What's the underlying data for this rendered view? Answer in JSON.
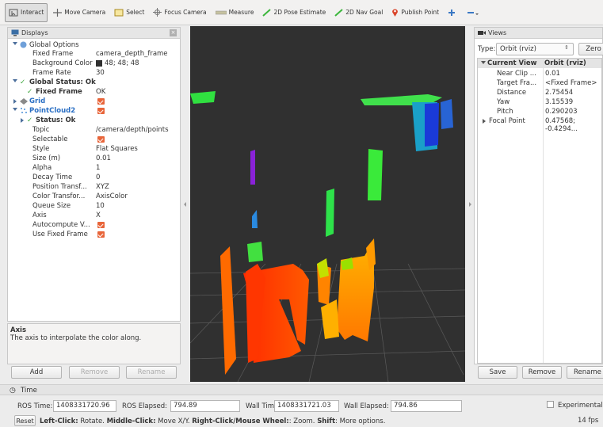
{
  "toolbar": {
    "interact": "Interact",
    "move_camera": "Move Camera",
    "select": "Select",
    "focus_camera": "Focus Camera",
    "measure": "Measure",
    "pose_estimate": "2D Pose Estimate",
    "nav_goal": "2D Nav Goal",
    "publish_point": "Publish Point"
  },
  "displays": {
    "title": "Displays",
    "global_options": "Global Options",
    "fixed_frame_label": "Fixed Frame",
    "fixed_frame_value": "camera_depth_frame",
    "bg_color_label": "Background Color",
    "bg_color_value": "48; 48; 48",
    "bg_color_swatch": "#303030",
    "frame_rate_label": "Frame Rate",
    "frame_rate_value": "30",
    "global_status": "Global Status: Ok",
    "fixed_frame_status_label": "Fixed Frame",
    "fixed_frame_status_value": "OK",
    "grid": "Grid",
    "pointcloud": "PointCloud2",
    "status_ok": "Status: Ok",
    "props": [
      {
        "label": "Topic",
        "value": "/camera/depth/points"
      },
      {
        "label": "Selectable",
        "value": "",
        "checkbox": true
      },
      {
        "label": "Style",
        "value": "Flat Squares"
      },
      {
        "label": "Size (m)",
        "value": "0.01"
      },
      {
        "label": "Alpha",
        "value": "1"
      },
      {
        "label": "Decay Time",
        "value": "0"
      },
      {
        "label": "Position Transf...",
        "value": "XYZ"
      },
      {
        "label": "Color Transfor...",
        "value": "AxisColor"
      },
      {
        "label": "Queue Size",
        "value": "10"
      },
      {
        "label": "Axis",
        "value": "X"
      },
      {
        "label": "Autocompute V...",
        "value": "",
        "checkbox": true
      },
      {
        "label": "Use Fixed Frame",
        "value": "",
        "checkbox": true
      }
    ]
  },
  "help": {
    "title": "Axis",
    "text": "The axis to interpolate the color along."
  },
  "display_buttons": {
    "add": "Add",
    "remove": "Remove",
    "rename": "Rename"
  },
  "views": {
    "title": "Views",
    "type_label": "Type:",
    "type_value": "Orbit (rviz)",
    "zero": "Zero",
    "current_view": "Current View",
    "current_view_value": "Orbit (rviz)",
    "rows": [
      {
        "label": "Near Clip ...",
        "value": "0.01"
      },
      {
        "label": "Target Fra...",
        "value": "<Fixed Frame>"
      },
      {
        "label": "Distance",
        "value": "2.75454"
      },
      {
        "label": "Yaw",
        "value": "3.15539"
      },
      {
        "label": "Pitch",
        "value": "0.290203"
      }
    ],
    "focal_label": "Focal Point",
    "focal_value": "0.47568; -0.4294...",
    "save": "Save",
    "remove": "Remove",
    "rename": "Rename"
  },
  "time": {
    "title": "Time",
    "ros_time_label": "ROS Time:",
    "ros_time": "1408331720.96",
    "ros_elapsed_label": "ROS Elapsed:",
    "ros_elapsed": "794.89",
    "wall_time_label": "Wall Time:",
    "wall_time": "1408331721.03",
    "wall_elapsed_label": "Wall Elapsed:",
    "wall_elapsed": "794.86",
    "experimental": "Experimental"
  },
  "status": {
    "reset": "Reset",
    "left": "Left-Click:",
    "left_t": " Rotate. ",
    "middle": "Middle-Click:",
    "middle_t": " Move X/Y. ",
    "right": "Right-Click/Mouse Wheel:",
    "right_t": ": Zoom. ",
    "shift": "Shift",
    "shift_t": ": More options.",
    "fps": "14 fps"
  }
}
